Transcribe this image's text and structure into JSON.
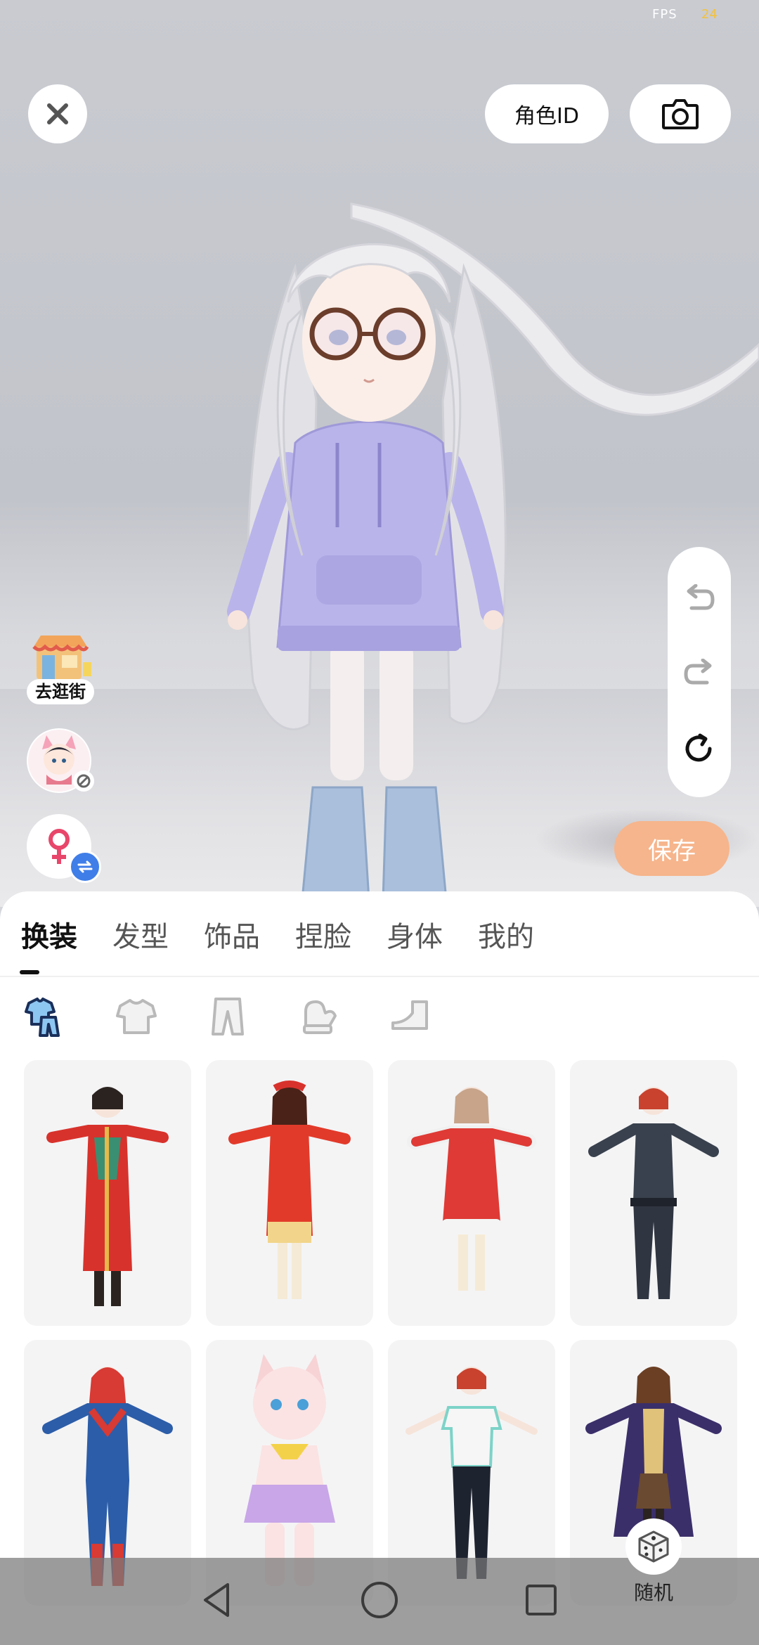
{
  "status": {
    "fps_label": "FPS",
    "fps_value": "24"
  },
  "top_bar": {
    "role_id_label": "角色ID"
  },
  "side": {
    "street_label": "去逛街"
  },
  "actions": {
    "save_label": "保存"
  },
  "tabs": [
    {
      "label": "换装",
      "active": true
    },
    {
      "label": "发型",
      "active": false
    },
    {
      "label": "饰品",
      "active": false
    },
    {
      "label": "捏脸",
      "active": false
    },
    {
      "label": "身体",
      "active": false
    },
    {
      "label": "我的",
      "active": false
    }
  ],
  "subcategories": [
    "outfit-set-icon",
    "top-icon",
    "pants-icon",
    "glove-icon",
    "shoe-icon"
  ],
  "outfits": [
    {
      "icon": "red-gold-qipao-outfit-thumbnail"
    },
    {
      "icon": "red-coat-dress-outfit-thumbnail"
    },
    {
      "icon": "red-christmas-outfit-thumbnail"
    },
    {
      "icon": "black-tactical-suit-thumbnail"
    },
    {
      "icon": "blue-red-hero-suit-thumbnail"
    },
    {
      "icon": "pink-cat-costume-thumbnail"
    },
    {
      "icon": "sporty-tshirt-outfit-thumbnail"
    },
    {
      "icon": "school-robe-outfit-thumbnail"
    }
  ],
  "random": {
    "label": "随机"
  },
  "colors": {
    "accent": "#f6b58c",
    "hoodie": "#b9b4ea",
    "bootie": "#a9bfdc",
    "gender_badge": "#3f7ee8"
  }
}
